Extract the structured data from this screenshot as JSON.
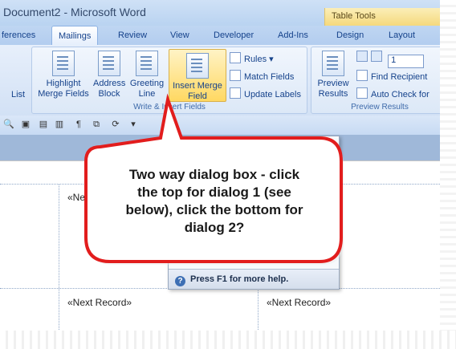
{
  "window": {
    "title": "Document2 - Microsoft Word",
    "context_group": "Table Tools"
  },
  "tabs": [
    {
      "label": "ferences"
    },
    {
      "label": "Mailings"
    },
    {
      "label": "Review"
    },
    {
      "label": "View"
    },
    {
      "label": "Developer"
    },
    {
      "label": "Add-Ins"
    },
    {
      "label": "Design"
    },
    {
      "label": "Layout"
    }
  ],
  "ribbon": {
    "left_partial_label": "List",
    "write_insert": {
      "label": "Write & Insert Fields",
      "highlight": "Highlight Merge Fields",
      "address": "Address Block",
      "greeting": "Greeting Line",
      "insert_merge": "Insert Merge Field",
      "rules": "Rules",
      "match": "Match Fields",
      "update": "Update Labels"
    },
    "preview": {
      "label": "Preview Results",
      "preview_results": "Preview Results",
      "record_value": "1",
      "find": "Find Recipient",
      "auto": "Auto Check for"
    }
  },
  "document": {
    "cell_1": "«Nex",
    "cell_2": "«Next Record»",
    "cell_3": "«Next Record»"
  },
  "dropdown": {
    "help_text": "Press F1 for more help."
  },
  "callout": {
    "text_1": "Two way dialog box - click",
    "text_2": "the top for dialog 1 (see",
    "text_3": "below), click the bottom for",
    "text_4": "dialog 2?"
  },
  "colors": {
    "callout_red": "#e21d1d",
    "ribbon_blue": "#d2e1f5",
    "highlight": "#ffd862"
  }
}
